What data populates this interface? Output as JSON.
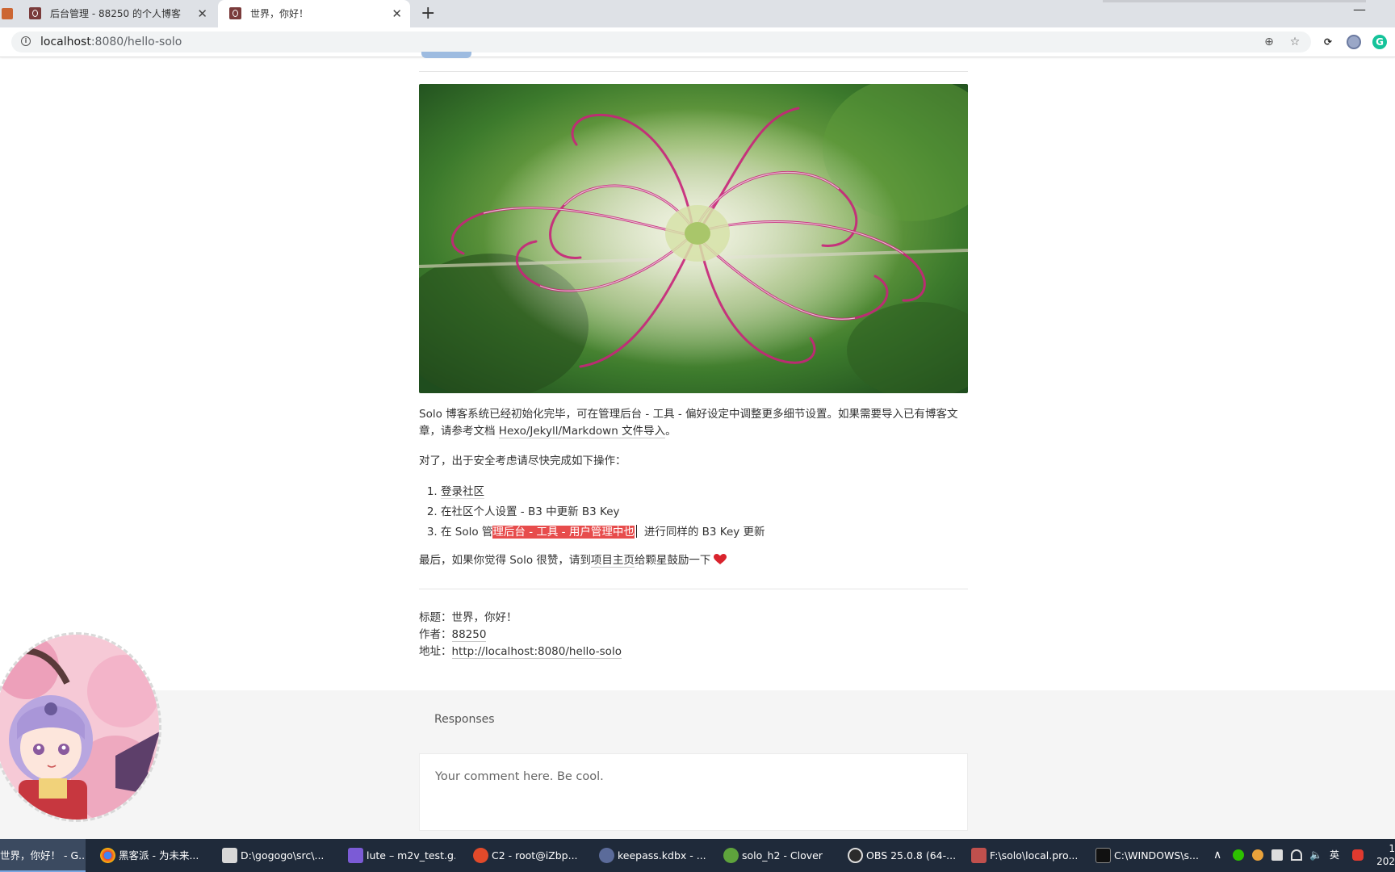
{
  "browser": {
    "tabs": [
      {
        "title": "后台管理 - 88250 的个人博客",
        "active": false
      },
      {
        "title": "世界，你好！",
        "active": true
      }
    ],
    "new_tab_label": "+",
    "close_glyph": "✕",
    "window_minimize": "—",
    "url_host": "localhost",
    "url_rest": ":8080/hello-solo"
  },
  "article": {
    "intro_part1": "Solo 博客系统已经初始化完毕，可在管理后台 - 工具 - 偏好设定中调整更多细节设置。如果需要导入已有博客文章，请参考文档 ",
    "intro_link": "Hexo/Jekyll/Markdown 文件导入",
    "intro_end": "。",
    "security_note": "对了，出于安全考虑请尽快完成如下操作：",
    "steps": {
      "s1": "登录社区",
      "s2": "在社区个人设置 - B3 中更新 B3 Key",
      "s3_before": "在 Solo 管",
      "s3_selected": "理后台 - 工具 - 用户管理中也",
      "s3_after": "进行同样的 B3 Key 更新"
    },
    "closing_before": "最后，如果你觉得 Solo 很赞，请到",
    "closing_link": "项目主页",
    "closing_after": "给颗星鼓励一下"
  },
  "meta": {
    "title_label": "标题：",
    "title_value": "世界，你好！",
    "author_label": "作者：",
    "author_value": "88250",
    "url_label": "地址：",
    "url_value": "http://localhost:8080/hello-solo"
  },
  "responses": {
    "heading": "Responses",
    "placeholder": "Your comment here. Be cool."
  },
  "taskbar": {
    "items": [
      {
        "label": "世界，你好！ - G...",
        "icon": "chrome-icon"
      },
      {
        "label": "黑客派 - 为未来...",
        "icon": "chrome-icon"
      },
      {
        "label": "D:\\gogogo\\src\\...",
        "icon": "folder-icon"
      },
      {
        "label": "lute – m2v_test.g...",
        "icon": "goland-icon"
      },
      {
        "label": "C2 - root@iZbp...",
        "icon": "terminal-icon"
      },
      {
        "label": "keepass.kdbx - ...",
        "icon": "keepass-icon"
      },
      {
        "label": "solo_h2 - Clover",
        "icon": "clover-icon"
      },
      {
        "label": "OBS 25.0.8 (64-...",
        "icon": "obs-icon"
      },
      {
        "label": "F:\\solo\\local.pro...",
        "icon": "notepad-icon"
      },
      {
        "label": "C:\\WINDOWS\\s...",
        "icon": "cmd-icon"
      }
    ],
    "tray_ime": "英",
    "clock_line1": "1",
    "clock_line2": "202"
  },
  "colors": {
    "selection": "#e74c4c",
    "heart": "#d9232d",
    "taskbar": "#1f2a3a"
  }
}
